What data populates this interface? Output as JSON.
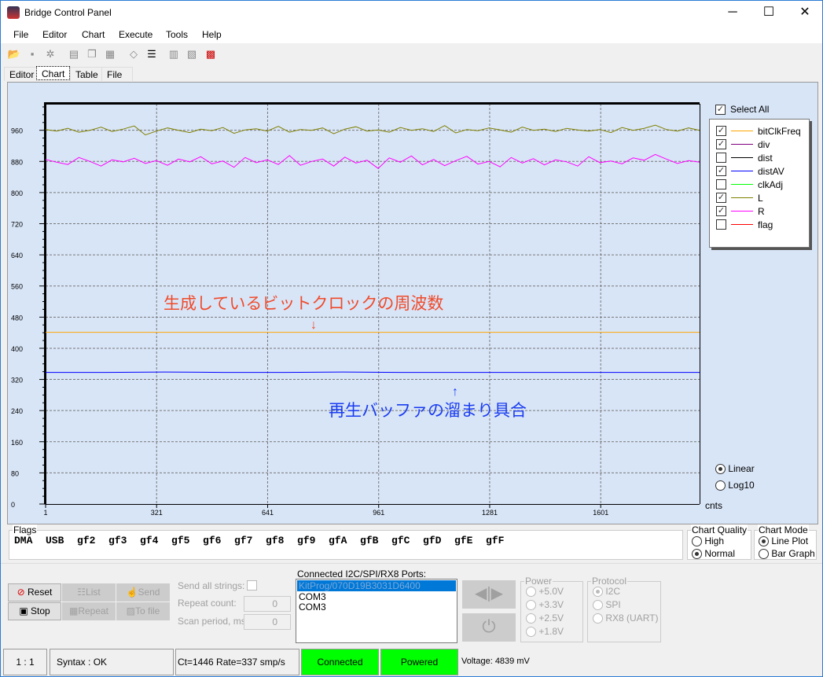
{
  "window": {
    "title": "Bridge Control Panel",
    "minimize": "─",
    "maximize": "☐",
    "close": "✕"
  },
  "menu": [
    "File",
    "Editor",
    "Chart",
    "Execute",
    "Tools",
    "Help"
  ],
  "toolbar": [
    "open-icon",
    "save-icon",
    "save-all-icon",
    "copy-format-icon",
    "copy-icon",
    "paste-icon",
    "eraser-icon",
    "lines-icon",
    "chart-zoom-icon",
    "chart-search-icon",
    "chart-color-icon"
  ],
  "tabs": [
    "Editor",
    "Chart",
    "Table",
    "File"
  ],
  "chart": {
    "select_all": "Select All",
    "legend": [
      {
        "name": "bitClkFreq",
        "color": "#ffa500",
        "checked": true
      },
      {
        "name": "div",
        "color": "#800080",
        "checked": true
      },
      {
        "name": "dist",
        "color": "#000000",
        "checked": false
      },
      {
        "name": "distAV",
        "color": "#0000ff",
        "checked": true
      },
      {
        "name": "clkAdj",
        "color": "#00ff00",
        "checked": false
      },
      {
        "name": "L",
        "color": "#808000",
        "checked": true
      },
      {
        "name": "R",
        "color": "#ff00ff",
        "checked": true
      },
      {
        "name": "flag",
        "color": "#ff0000",
        "checked": false
      }
    ],
    "scale": {
      "linear": "Linear",
      "log10": "Log10",
      "selected": "Linear"
    },
    "annotation_red": "生成しているビットクロックの周波数",
    "annotation_blue": "再生バッファの溜まり具合",
    "arrow_down": "↓",
    "arrow_up": "↑"
  },
  "chart_data": {
    "type": "line",
    "xlabel": "cnts",
    "ylabel": "",
    "xlim": [
      1,
      1886
    ],
    "ylim": [
      0,
      1028
    ],
    "xticks": [
      1,
      321,
      641,
      961,
      1281,
      1601
    ],
    "yticks": [
      0,
      80,
      160,
      240,
      320,
      400,
      480,
      560,
      640,
      720,
      800,
      880,
      960
    ],
    "grid": true,
    "legend_placement": "right",
    "series": [
      {
        "name": "bitClkFreq",
        "color": "#ffa500",
        "values": [
          441,
          441
        ]
      },
      {
        "name": "distAV",
        "color": "#0000ff",
        "values": [
          338,
          338,
          339,
          338,
          338,
          339,
          338,
          338,
          338,
          338,
          338,
          338
        ]
      },
      {
        "name": "L",
        "color": "#808000",
        "values": [
          962,
          958,
          965,
          955,
          960,
          968,
          957,
          963,
          971,
          948,
          958,
          966,
          960,
          954,
          963,
          959,
          967,
          952,
          961,
          964,
          958,
          970,
          955,
          962,
          960,
          966,
          951,
          963,
          969,
          958,
          961,
          955,
          967,
          960,
          964,
          957,
          972,
          953,
          962,
          959,
          966,
          961,
          955,
          968,
          960,
          963,
          957,
          965,
          961,
          958,
          962,
          954,
          967,
          960,
          965,
          973,
          962,
          958,
          966,
          960
        ]
      },
      {
        "name": "R",
        "color": "#ff00ff",
        "values": [
          885,
          878,
          872,
          890,
          880,
          868,
          884,
          879,
          888,
          875,
          882,
          870,
          886,
          879,
          892,
          874,
          881,
          865,
          890,
          877,
          884,
          872,
          895,
          870,
          880,
          886,
          868,
          891,
          876,
          883,
          862,
          889,
          878,
          894,
          871,
          885,
          869,
          882,
          893,
          873,
          880,
          866,
          890,
          876,
          887,
          871,
          884,
          879,
          868,
          892,
          877,
          881,
          874,
          889,
          883,
          898,
          886,
          875,
          882,
          878
        ]
      }
    ]
  },
  "flags": {
    "title": "Flags",
    "items": [
      "DMA",
      "USB",
      "gf2",
      "gf3",
      "gf4",
      "gf5",
      "gf6",
      "gf7",
      "gf8",
      "gf9",
      "gfA",
      "gfB",
      "gfC",
      "gfD",
      "gfE",
      "gfF"
    ]
  },
  "chart_quality": {
    "title": "Chart Quality",
    "options": [
      "High",
      "Normal"
    ],
    "selected": "Normal"
  },
  "chart_mode": {
    "title": "Chart Mode",
    "options": [
      "Line Plot",
      "Bar Graph"
    ],
    "selected": "Line Plot"
  },
  "controls": {
    "reset": "Reset",
    "stop": "Stop",
    "list": "List",
    "repeat": "Repeat",
    "send": "Send",
    "to_file": "To file",
    "send_all": "Send all strings:",
    "repeat_count": "Repeat count:",
    "repeat_value": "0",
    "scan_period": "Scan period, ms:",
    "scan_value": "0"
  },
  "ports": {
    "title": "Connected I2C/SPI/RX8 Ports:",
    "items": [
      "KitProg/070D19B3031D6400",
      "COM3",
      "COM3"
    ],
    "selected": 0
  },
  "power": {
    "title": "Power",
    "options": [
      "+5.0V",
      "+3.3V",
      "+2.5V",
      "+1.8V"
    ]
  },
  "protocol": {
    "title": "Protocol",
    "options": [
      "I2C",
      "SPI",
      "RX8 (UART)"
    ],
    "selected": "I2C"
  },
  "status": {
    "pos": "1 : 1",
    "syntax": "Syntax : OK",
    "rate": "Ct=1446 Rate=337 smp/s",
    "connected": "Connected",
    "powered": "Powered",
    "voltage": "Voltage: 4839 mV"
  }
}
